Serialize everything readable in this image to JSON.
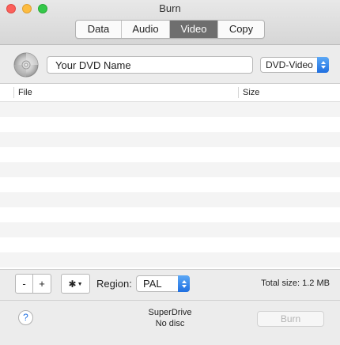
{
  "window": {
    "title": "Burn"
  },
  "tabs": [
    {
      "label": "Data",
      "active": false
    },
    {
      "label": "Audio",
      "active": false
    },
    {
      "label": "Video",
      "active": true
    },
    {
      "label": "Copy",
      "active": false
    }
  ],
  "disc": {
    "name_value": "Your DVD Name",
    "format_selected": "DVD-Video"
  },
  "file_list": {
    "columns": [
      "File",
      "Size"
    ],
    "rows": []
  },
  "toolbar": {
    "remove_label": "-",
    "add_label": "+",
    "action_icon": "gear-icon",
    "region_label": "Region:",
    "region_selected": "PAL",
    "total_size": "Total size: 1.2 MB"
  },
  "footer": {
    "help_label": "?",
    "drive_name": "SuperDrive",
    "drive_status": "No disc",
    "burn_label": "Burn"
  },
  "colors": {
    "accent": "#1f6fe0",
    "active_tab": "#6e6e6e",
    "close": "#fc605b",
    "minimize": "#fdbc40",
    "zoom": "#34c84a"
  }
}
